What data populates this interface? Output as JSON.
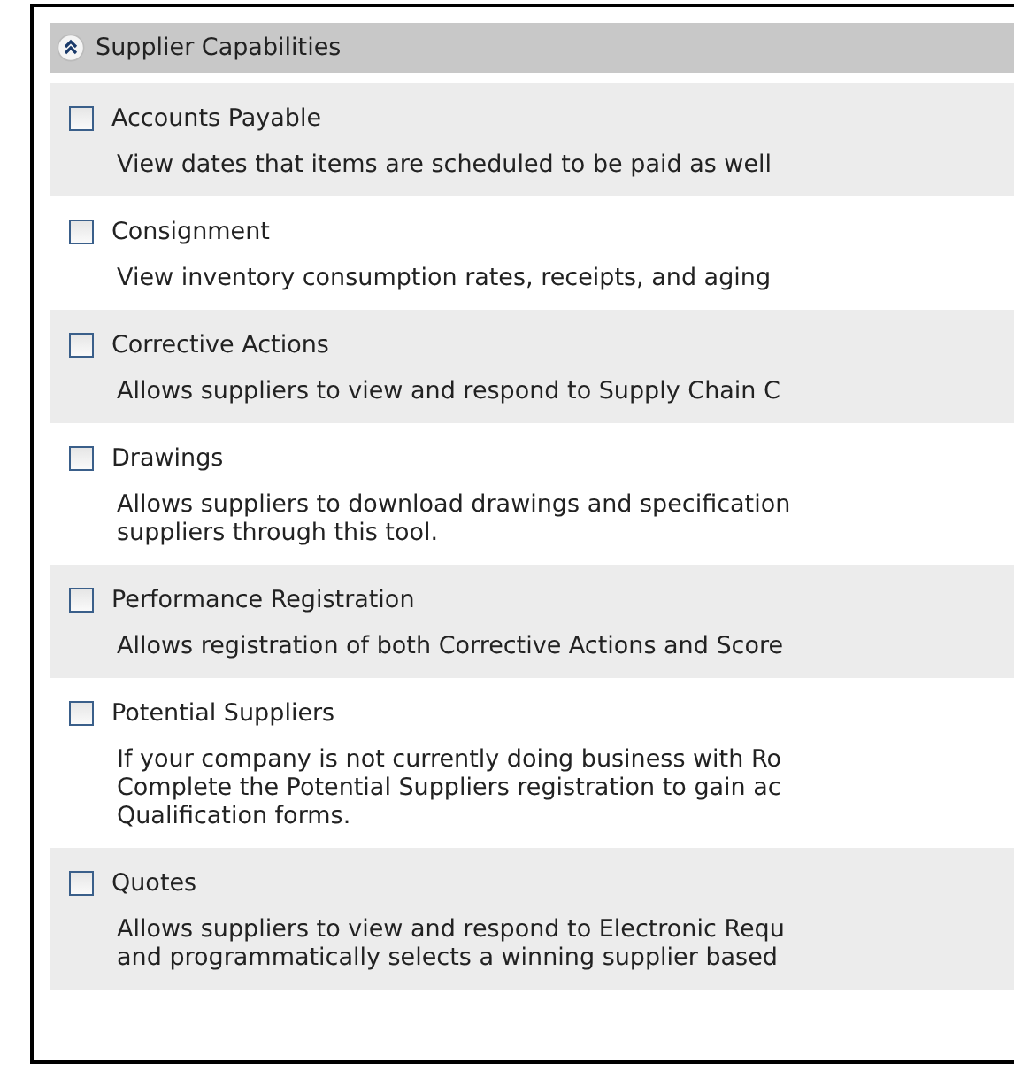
{
  "section": {
    "title": "Supplier Capabilities",
    "expanded": true,
    "items": [
      {
        "label": "Accounts Payable",
        "checked": false,
        "description": [
          "View dates that items are scheduled to be paid as well"
        ]
      },
      {
        "label": "Consignment",
        "checked": false,
        "description": [
          "View inventory consumption rates, receipts, and aging"
        ]
      },
      {
        "label": "Corrective Actions",
        "checked": false,
        "description": [
          "Allows suppliers to view and respond to Supply Chain C"
        ]
      },
      {
        "label": "Drawings",
        "checked": false,
        "description": [
          "Allows suppliers to download drawings and specification",
          "suppliers through this tool."
        ]
      },
      {
        "label": "Performance Registration",
        "checked": false,
        "description": [
          "Allows registration of both Corrective Actions and Score"
        ]
      },
      {
        "label": "Potential Suppliers",
        "checked": false,
        "description": [
          "If your company is not currently doing business with Ro",
          "Complete the Potential Suppliers registration to gain ac",
          "Qualification forms."
        ]
      },
      {
        "label": "Quotes",
        "checked": false,
        "description": [
          "Allows suppliers to view and respond to Electronic Requ",
          "and programmatically selects a winning supplier based"
        ]
      }
    ]
  }
}
